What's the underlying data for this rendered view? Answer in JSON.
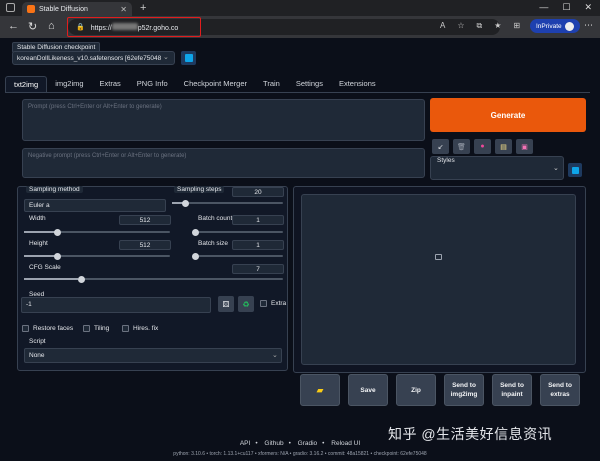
{
  "browser": {
    "tab_title": "Stable Diffusion",
    "url_prefix": "https://",
    "url_suffix": "p52r.goho.co",
    "profile_label": "InPrivate"
  },
  "checkpoint": {
    "label": "Stable Diffusion checkpoint",
    "value": "koreanDollLikeness_v10.safetensors [62efe75048"
  },
  "tabs": [
    "txt2img",
    "img2img",
    "Extras",
    "PNG Info",
    "Checkpoint Merger",
    "Train",
    "Settings",
    "Extensions"
  ],
  "prompt": {
    "placeholder": "Prompt (press Ctrl+Enter or Alt+Enter to generate)",
    "negative_placeholder": "Negative prompt (press Ctrl+Enter or Alt+Enter to generate)"
  },
  "generate": {
    "label": "Generate"
  },
  "styles": {
    "label": "Styles"
  },
  "params": {
    "sampling_method_label": "Sampling method",
    "sampling_method": "Euler a",
    "sampling_steps_label": "Sampling steps",
    "sampling_steps": "20",
    "width_label": "Width",
    "width": "512",
    "height_label": "Height",
    "height": "512",
    "batch_count_label": "Batch count",
    "batch_count": "1",
    "batch_size_label": "Batch size",
    "batch_size": "1",
    "cfg_label": "CFG Scale",
    "cfg": "7",
    "seed_label": "Seed",
    "seed": "-1",
    "extra_label": "Extra",
    "restore_faces_label": "Restore faces",
    "tiling_label": "Tiling",
    "hires_label": "Hires. fix",
    "script_label": "Script",
    "script": "None"
  },
  "actions": {
    "save": "Save",
    "zip": "Zip",
    "send_img2img": "Send to img2img",
    "send_inpaint": "Send to inpaint",
    "send_extras": "Send to extras"
  },
  "footer": {
    "links": [
      "API",
      "Github",
      "Gradio",
      "Reload UI"
    ],
    "version": "python: 3.10.6  •  torch: 1.13.1+cu117  •  xformers: N/A  •  gradio: 3.16.2  •  commit: 48a15821  •  checkpoint: 62efe75048"
  },
  "watermark": "知乎 @生活美好信息资讯"
}
